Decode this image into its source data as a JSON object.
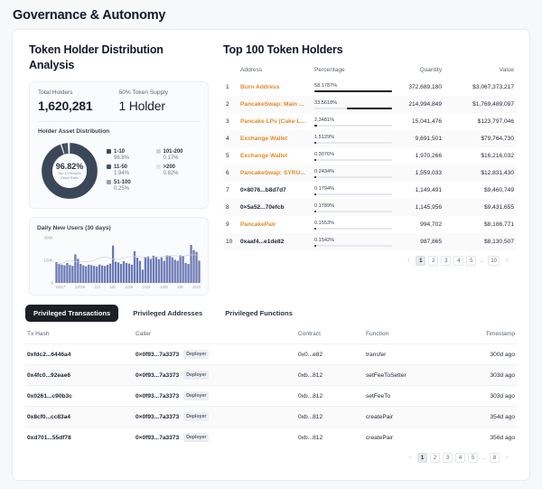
{
  "header": {
    "title": "Governance & Autonomy"
  },
  "left_panel": {
    "title": "Token Holder Distribution Analysis",
    "stats": [
      {
        "label": "Total Holders",
        "value": "1,620,281"
      },
      {
        "label": "50% Token Supply",
        "value": "1 Holder"
      }
    ],
    "distribution": {
      "title": "Holder Asset Distribution",
      "center_value": "96.82%",
      "center_caption_1": "Top 10 Holders",
      "center_caption_2": "Asset Ratio",
      "legend": [
        {
          "name": "1-10",
          "value": "96.8%",
          "color": "#3a4758"
        },
        {
          "name": "101-200",
          "value": "0.17%",
          "color": "#ccd3dd"
        },
        {
          "name": "11-50",
          "value": "1.94%",
          "color": "#43536a"
        },
        {
          "name": ">200",
          "value": "0.82%",
          "color": "#e2e7ee"
        },
        {
          "name": "51-100",
          "value": "0.25%",
          "color": "#93a2b6"
        }
      ]
    },
    "daily_chart": {
      "title": "Daily New Users (30 days)"
    }
  },
  "chart_data": [
    {
      "type": "pie",
      "title": "Holder Asset Distribution",
      "labels": [
        "1-10",
        "11-50",
        "51-100",
        "101-200",
        ">200"
      ],
      "values": [
        96.8,
        1.94,
        0.25,
        0.17,
        0.82
      ],
      "colors": [
        "#3a4758",
        "#43536a",
        "#93a2b6",
        "#ccd3dd",
        "#e2e7ee"
      ],
      "legend": "right",
      "annotation": "96.82% Top 10 Holders Asset Ratio"
    },
    {
      "type": "bar",
      "title": "Daily New Users (30 days)",
      "xlabel": "",
      "ylabel": "",
      "ylim": [
        0,
        300000
      ],
      "yticks": [
        0,
        150000,
        300000
      ],
      "ytick_labels": [
        "0",
        "150K",
        "300K"
      ],
      "grid": true,
      "xtick_labels": [
        "12/17",
        "12/26",
        "1/2",
        "1/8",
        "1/15",
        "1/22",
        "1/29",
        "2/5",
        "2/13"
      ],
      "bar_color": "#6b79b5",
      "line_color": "#c9cfe3",
      "values": [
        138000,
        128000,
        121000,
        117000,
        132000,
        119000,
        113000,
        190000,
        160000,
        126000,
        116000,
        110000,
        121000,
        118000,
        113000,
        109000,
        122000,
        116000,
        112000,
        120000,
        128000,
        248000,
        141000,
        136000,
        126000,
        143000,
        132000,
        128000,
        121000,
        211000,
        168000,
        146000,
        88000,
        171000,
        176000,
        159000,
        181000,
        175000,
        158000,
        169000,
        146000,
        183000,
        180000,
        170000,
        154000,
        147000,
        183000,
        180000,
        133000,
        126000,
        252000,
        218000,
        206000,
        148000
      ],
      "trend": [
        128000,
        126000,
        129000,
        137000,
        146000,
        150000,
        147000,
        142000,
        139000,
        138000,
        139000,
        141000,
        143000,
        146000,
        151000,
        158000,
        165000,
        171000,
        172000,
        168000,
        163000,
        159000,
        157000,
        158000,
        162000,
        167000,
        170000,
        172000,
        175000,
        177000,
        178000,
        176000,
        173000,
        170000,
        168000,
        167000,
        168000,
        170000,
        172000,
        174000,
        176000,
        178000,
        180000,
        181000,
        180000,
        178000,
        177000,
        178000,
        180000,
        183000,
        186000,
        187000,
        185000,
        181000
      ]
    }
  ],
  "holders_panel": {
    "title": "Top 100 Token Holders",
    "columns": [
      "Address",
      "Percentage",
      "Quantity",
      "Value"
    ],
    "rank_header": "",
    "rows": [
      {
        "rank": "1",
        "address": "Burn Address",
        "is_link": true,
        "percentage": "58.1787%",
        "pct": 58.1787,
        "quantity": "372,689,180",
        "value": "$3,067,373,217"
      },
      {
        "rank": "2",
        "address": "PancakeSwap: Main ...",
        "is_link": true,
        "percentage": "33.5618%",
        "pct": 33.5618,
        "quantity": "214,994,849",
        "value": "$1,769,489,097"
      },
      {
        "rank": "3",
        "address": "Pancake LPs (Cake-L...",
        "is_link": true,
        "percentage": "2.3481%",
        "pct": 2.3481,
        "quantity": "15,041,476",
        "value": "$123,797,046"
      },
      {
        "rank": "4",
        "address": "Exchange Wallet",
        "is_link": true,
        "percentage": "1.5129%",
        "pct": 1.5129,
        "quantity": "9,691,501",
        "value": "$79,764,730"
      },
      {
        "rank": "5",
        "address": "Exchange Wallet",
        "is_link": true,
        "percentage": "0.3076%",
        "pct": 0.3076,
        "quantity": "1,970,266",
        "value": "$16,216,032"
      },
      {
        "rank": "6",
        "address": "PancakeSwap: SYRU...",
        "is_link": true,
        "percentage": "0.2434%",
        "pct": 0.2434,
        "quantity": "1,559,033",
        "value": "$12,831,430"
      },
      {
        "rank": "7",
        "address": "0×8076...b8d7d7",
        "is_link": false,
        "percentage": "0.1794%",
        "pct": 0.1794,
        "quantity": "1,149,491",
        "value": "$9,460,749"
      },
      {
        "rank": "8",
        "address": "0×5a52...70efcb",
        "is_link": false,
        "percentage": "0.1789%",
        "pct": 0.1789,
        "quantity": "1,145,956",
        "value": "$9,431,655"
      },
      {
        "rank": "9",
        "address": "PancakePair",
        "is_link": true,
        "percentage": "0.1553%",
        "pct": 0.1553,
        "quantity": "994,702",
        "value": "$8,186,771"
      },
      {
        "rank": "10",
        "address": "0xaaf4...e1de82",
        "is_link": false,
        "percentage": "0.1542%",
        "pct": 0.1542,
        "quantity": "987,865",
        "value": "$8,130,507"
      }
    ],
    "pagination": {
      "prev": "‹",
      "next": "›",
      "dots": "...",
      "pages": [
        "1",
        "2",
        "3",
        "4",
        "5"
      ],
      "last": "10",
      "active": "1"
    }
  },
  "tabs": [
    {
      "label": "Privileged Transactions",
      "active": true
    },
    {
      "label": "Privileged Addresses",
      "active": false
    },
    {
      "label": "Privileged Functions",
      "active": false
    }
  ],
  "transactions_table": {
    "columns": [
      "Tx Hash",
      "Caller",
      "Contract",
      "Function",
      "Timestamp"
    ],
    "rows": [
      {
        "tx_hash": "0xfdc2...6446a4",
        "caller": "0×0f93...7a3373",
        "badge": "Deployer",
        "contract": "0x0...e82",
        "function": "transfer",
        "timestamp": "300d ago"
      },
      {
        "tx_hash": "0x4fc0...92eae6",
        "caller": "0×0f93...7a3373",
        "badge": "Deployer",
        "contract": "0xb...812",
        "function": "setFeeToSetter",
        "timestamp": "303d ago"
      },
      {
        "tx_hash": "0x0261...c90b3c",
        "caller": "0×0f93...7a3373",
        "badge": "Deployer",
        "contract": "0xb...812",
        "function": "setFeeTo",
        "timestamp": "303d ago"
      },
      {
        "tx_hash": "0x8cf0...cc83a4",
        "caller": "0×0f93...7a3373",
        "badge": "Deployer",
        "contract": "0xb...812",
        "function": "createPair",
        "timestamp": "354d ago"
      },
      {
        "tx_hash": "0xd701...55df78",
        "caller": "0×0f93...7a3373",
        "badge": "Deployer",
        "contract": "0xb...812",
        "function": "createPair",
        "timestamp": "356d ago"
      }
    ],
    "pagination": {
      "prev": "‹",
      "next": "›",
      "dots": "...",
      "pages": [
        "1",
        "2",
        "3",
        "4",
        "5"
      ],
      "last": "8",
      "active": "1"
    }
  }
}
